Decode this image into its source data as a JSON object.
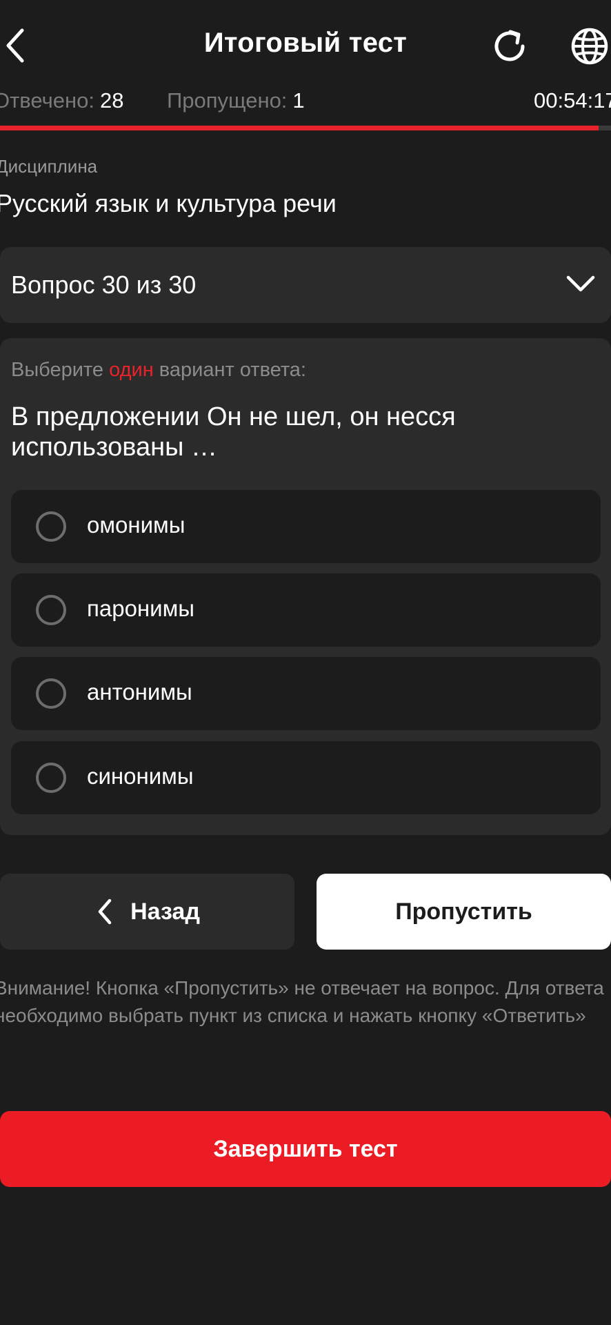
{
  "header": {
    "title": "Итоговый тест",
    "back_icon": "chevron-left-icon",
    "refresh_icon": "refresh-icon",
    "language_icon": "globe-icon"
  },
  "stats": {
    "answered_label": "Отвечено:",
    "answered_value": "28",
    "skipped_label": "Пропущено:",
    "skipped_value": "1",
    "timer": "00:54:17"
  },
  "progress": {
    "value_percent": 98,
    "fill_color": "#e8232b",
    "track_color": "#3a3a3a"
  },
  "discipline": {
    "label": "Дисциплина",
    "name": "Русский язык и культура речи"
  },
  "question_selector": {
    "label": "Вопрос 30 из 30"
  },
  "question": {
    "instruction_prefix": "Выберите ",
    "instruction_accent": "один",
    "instruction_suffix": " вариант ответа:",
    "text": "В предложении Он не шел, он несся использованы …",
    "options": [
      {
        "label": "омонимы"
      },
      {
        "label": "паронимы"
      },
      {
        "label": "антонимы"
      },
      {
        "label": "синонимы"
      }
    ]
  },
  "actions": {
    "back_label": "Назад",
    "skip_label": "Пропустить",
    "finish_label": "Завершить тест"
  },
  "notice": "Внимание! Кнопка «Пропустить» не отвечает на вопрос. Для ответа необходимо выбрать пункт из списка и нажать кнопку «Ответить»",
  "colors": {
    "background": "#1c1c1c",
    "card": "#2b2b2b",
    "accent": "#e8232b",
    "finish_button": "#ec1c24"
  }
}
